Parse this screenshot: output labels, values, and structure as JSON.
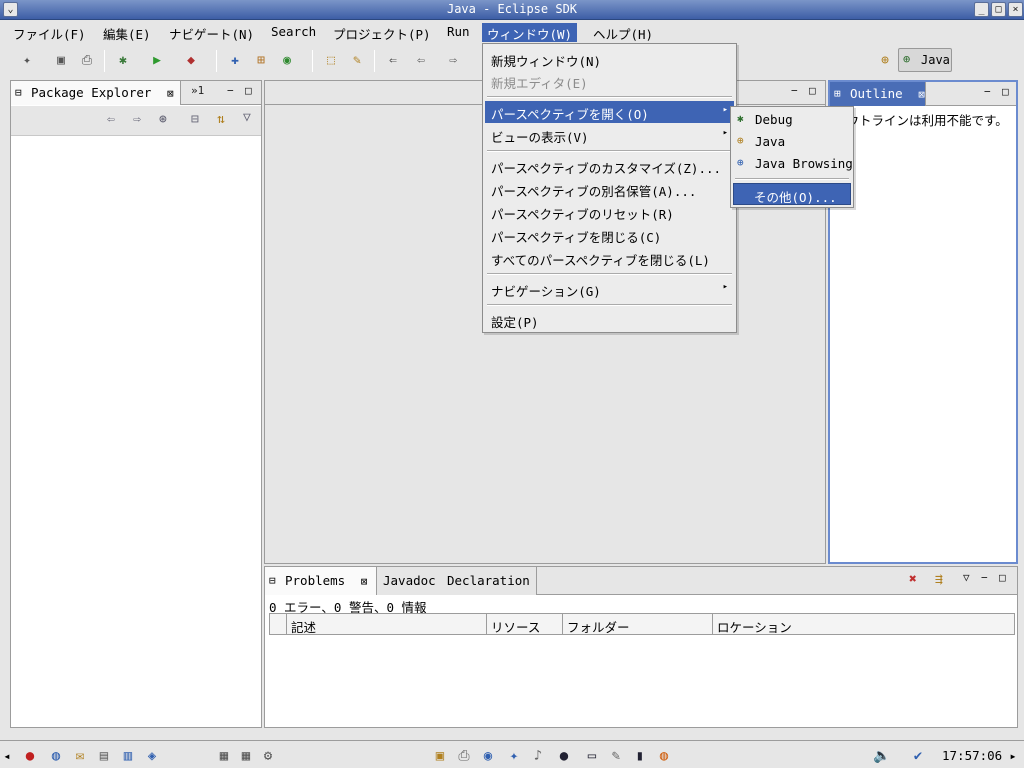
{
  "window": {
    "title": "Java - Eclipse SDK",
    "menu_button": "⌄",
    "controls": {
      "minimize": "_",
      "maximize": "□",
      "close": "×"
    }
  },
  "menubar": {
    "items": [
      {
        "label": "ファイル(F)"
      },
      {
        "label": "編集(E)"
      },
      {
        "label": "ナビゲート(N)"
      },
      {
        "label": "Search"
      },
      {
        "label": "プロジェクト(P)"
      },
      {
        "label": "Run"
      },
      {
        "label": "ウィンドウ(W)"
      },
      {
        "label": "ヘルプ(H)"
      }
    ]
  },
  "toolbar": {
    "icons": [
      {
        "name": "new-icon",
        "glyph": "✦"
      },
      {
        "name": "save-icon",
        "glyph": "▣"
      },
      {
        "name": "print-icon",
        "glyph": "⎙"
      },
      {
        "name": "debug-icon",
        "glyph": "✱"
      },
      {
        "name": "run-icon",
        "glyph": "▶"
      },
      {
        "name": "external-tools-icon",
        "glyph": "◆"
      },
      {
        "name": "new-java-project-icon",
        "glyph": "✚"
      },
      {
        "name": "new-package-icon",
        "glyph": "⊞"
      },
      {
        "name": "new-class-icon",
        "glyph": "◉"
      },
      {
        "name": "open-type-icon",
        "glyph": "⬚"
      },
      {
        "name": "search-icon",
        "glyph": "✎"
      },
      {
        "name": "last-edit-icon",
        "glyph": "⇐"
      },
      {
        "name": "back-icon",
        "glyph": "⇦"
      },
      {
        "name": "forward-icon",
        "glyph": "⇨"
      }
    ],
    "perspective_icon": "⊕",
    "perspective_label": "Java"
  },
  "package_explorer": {
    "tab_label": "Package Explorer",
    "tab_icon": "⊟",
    "close": "⊠",
    "overflow": "»1",
    "minimize": "−",
    "maximize": "□",
    "tools": [
      "⇦",
      "⇨",
      "⊛",
      "⊟",
      "⇅",
      "▽"
    ]
  },
  "editor": {
    "minimize": "−",
    "maximize": "□"
  },
  "window_menu": {
    "items": [
      {
        "label": "新規ウィンドウ(N)",
        "disabled": false
      },
      {
        "label": "新規エディタ(E)",
        "disabled": true
      },
      {
        "label": "パースペクティブを開く(O)",
        "selected": true,
        "submenu": true
      },
      {
        "label": "ビューの表示(V)",
        "submenu": true
      },
      {
        "label": "パースペクティブのカスタマイズ(Z)..."
      },
      {
        "label": "パースペクティブの別名保管(A)..."
      },
      {
        "label": "パースペクティブのリセット(R)"
      },
      {
        "label": "パースペクティブを閉じる(C)"
      },
      {
        "label": "すべてのパースペクティブを閉じる(L)"
      },
      {
        "label": "ナビゲーション(G)",
        "submenu": true
      },
      {
        "label": "設定(P)"
      }
    ],
    "submenu_arrow": "▸"
  },
  "open_perspective_submenu": {
    "items": [
      {
        "label": "Debug",
        "icon": "✱"
      },
      {
        "label": "Java",
        "icon": "⊕"
      },
      {
        "label": "Java Browsing",
        "icon": "⊕"
      },
      {
        "label": "その他(O)...",
        "selected": true
      }
    ]
  },
  "outline": {
    "tab_label": "Outline",
    "tab_icon": "⊞",
    "close": "⊠",
    "minimize": "−",
    "maximize": "□",
    "message": "アウトラインは利用不能です。"
  },
  "problems": {
    "tabs": [
      "Problems",
      "Javadoc",
      "Declaration"
    ],
    "tab_icon": "⊟",
    "close": "⊠",
    "summary": "0 エラー、0 警告、0 情報",
    "columns": [
      "",
      "記述",
      "リソース",
      "フォルダー",
      "ロケーション"
    ],
    "tools": [
      "✖",
      "⇶",
      "▽",
      "−",
      "□"
    ]
  },
  "taskbar": {
    "clock": "17:57:06",
    "left_scroll": "◂",
    "right_scroll": "▸",
    "volume_icon": "🔈",
    "update_icon": "✔"
  }
}
